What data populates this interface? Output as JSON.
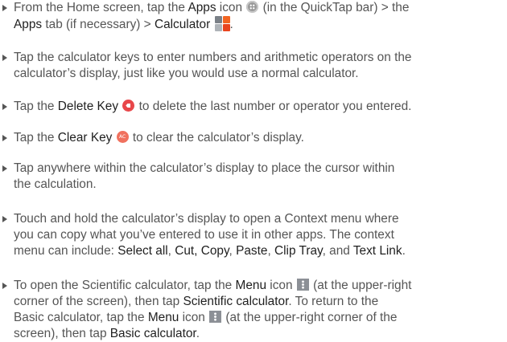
{
  "items": [
    {
      "lines": [
        [
          {
            "t": "From the Home screen, tap the "
          },
          {
            "t": "Apps",
            "b": true
          },
          {
            "t": " icon "
          },
          {
            "icon": "apps-icon"
          },
          {
            "t": " (in the QuickTap bar) > the"
          }
        ],
        [
          {
            "t": "Apps",
            "b": true
          },
          {
            "t": " tab (if necessary) > "
          },
          {
            "t": "Calculator",
            "b": true
          },
          {
            "t": " "
          },
          {
            "icon": "calculator-icon"
          },
          {
            "t": "."
          }
        ]
      ]
    },
    {
      "lines": [
        [
          {
            "t": "Tap the calculator keys to enter numbers and arithmetic operators on the"
          }
        ],
        [
          {
            "t": "calculator’s display, just like you would use a normal calculator."
          }
        ]
      ]
    },
    {
      "lines": [
        [
          {
            "t": "Tap the "
          },
          {
            "t": "Delete Key",
            "b": true
          },
          {
            "t": " "
          },
          {
            "icon": "delete-key-icon"
          },
          {
            "t": " to delete the last number or operator you entered."
          }
        ]
      ]
    },
    {
      "lines": [
        [
          {
            "t": "Tap the "
          },
          {
            "t": "Clear Key",
            "b": true
          },
          {
            "t": " "
          },
          {
            "icon": "clear-key-icon"
          },
          {
            "t": " to clear the calculator’s display."
          }
        ]
      ]
    },
    {
      "lines": [
        [
          {
            "t": "Tap anywhere within the calculator’s display to place the cursor within"
          }
        ],
        [
          {
            "t": "the calculation."
          }
        ]
      ]
    },
    {
      "lines": [
        [
          {
            "t": "Touch and hold the calculator’s display to open a Context menu where"
          }
        ],
        [
          {
            "t": "you can copy what you’ve entered to use it in other apps. The context"
          }
        ],
        [
          {
            "t": "menu can include: "
          },
          {
            "t": "Select all",
            "b": true
          },
          {
            "t": ", "
          },
          {
            "t": "Cut, Copy",
            "b": true
          },
          {
            "t": ", "
          },
          {
            "t": "Paste",
            "b": true
          },
          {
            "t": ", "
          },
          {
            "t": "Clip Tray",
            "b": true
          },
          {
            "t": ", and "
          },
          {
            "t": "Text Link",
            "b": true
          },
          {
            "t": "."
          }
        ]
      ]
    },
    {
      "lines": [
        [
          {
            "t": "To open the Scientific calculator, tap the "
          },
          {
            "t": "Menu",
            "b": true
          },
          {
            "t": " icon "
          },
          {
            "icon": "menu-icon"
          },
          {
            "t": " (at the upper-right"
          }
        ],
        [
          {
            "t": "corner of the screen), then tap "
          },
          {
            "t": "Scientific calculator",
            "b": true
          },
          {
            "t": ". To return to the"
          }
        ],
        [
          {
            "t": "Basic calculator, tap the "
          },
          {
            "t": "Menu",
            "b": true
          },
          {
            "t": " icon "
          },
          {
            "icon": "menu-icon"
          },
          {
            "t": " (at the upper-right corner of the"
          }
        ],
        [
          {
            "t": "screen), then tap "
          },
          {
            "t": "Basic calculator",
            "b": true
          },
          {
            "t": "."
          }
        ]
      ]
    }
  ],
  "colors": {
    "body_text": "#555555",
    "bold_text": "#1f1f1f",
    "calculator_icon": [
      "#7a8087",
      "#f26522",
      "#aeb3b8",
      "#e9451f"
    ]
  }
}
